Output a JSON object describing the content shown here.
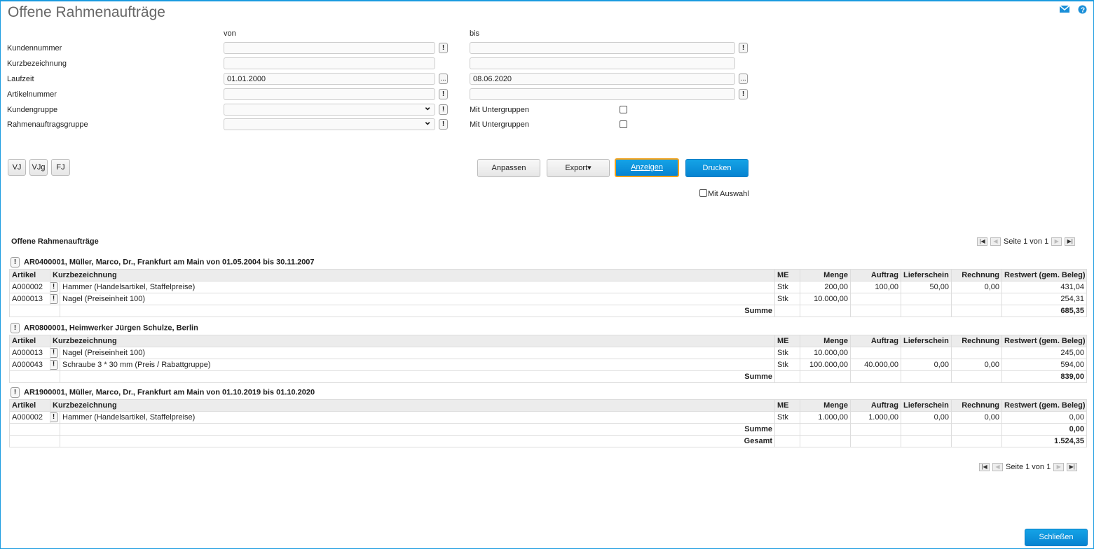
{
  "title": "Offene Rahmenaufträge",
  "icons": {
    "mail": "mail-icon",
    "help": "help-icon"
  },
  "filter": {
    "von": "von",
    "bis": "bis",
    "rows": [
      {
        "label": "Kundennummer",
        "von": "",
        "bis": ""
      },
      {
        "label": "Kurzbezeichnung",
        "von": "",
        "bis": ""
      },
      {
        "label": "Laufzeit",
        "von": "01.01.2000",
        "bis": "08.06.2020"
      },
      {
        "label": "Artikelnummer",
        "von": "",
        "bis": ""
      },
      {
        "label": "Kundengruppe",
        "von": "",
        "bis": "Mit Untergruppen"
      },
      {
        "label": "Rahmenauftragsgruppe",
        "von": "",
        "bis": "Mit Untergruppen"
      }
    ],
    "ellipsis": "...",
    "excl": "!"
  },
  "quick": [
    "VJ",
    "VJg",
    "FJ"
  ],
  "buttons": {
    "anpassen": "Anpassen",
    "export": "Export▾",
    "anzeigen": "Anzeigen",
    "drucken": "Drucken",
    "mit_auswahl": "Mit Auswahl",
    "schliessen": "Schließen"
  },
  "report": {
    "title": "Offene Rahmenaufträge",
    "pager": "Seite 1 von 1",
    "columns": [
      "Artikel",
      "Kurzbezeichnung",
      "ME",
      "Menge",
      "Auftrag",
      "Lieferschein",
      "Rechnung",
      "Restwert (gem. Beleg)"
    ],
    "groups": [
      {
        "title": "AR0400001, Müller, Marco, Dr., Frankfurt am Main von 01.05.2004 bis 30.11.2007",
        "rows": [
          [
            "A000002",
            "Hammer (Handelsartikel, Staffelpreise)",
            "Stk",
            "200,00",
            "100,00",
            "50,00",
            "0,00",
            "431,04"
          ],
          [
            "A000013",
            "Nagel (Preiseinheit 100)",
            "Stk",
            "10.000,00",
            "",
            "",
            "",
            "254,31"
          ]
        ],
        "summe_label": "Summe",
        "summe": "685,35"
      },
      {
        "title": "AR0800001, Heimwerker Jürgen Schulze, Berlin",
        "rows": [
          [
            "A000013",
            "Nagel (Preiseinheit 100)",
            "Stk",
            "10.000,00",
            "",
            "",
            "",
            "245,00"
          ],
          [
            "A000043",
            "Schraube 3 * 30 mm (Preis / Rabattgruppe)",
            "Stk",
            "100.000,00",
            "40.000,00",
            "0,00",
            "0,00",
            "594,00"
          ]
        ],
        "summe_label": "Summe",
        "summe": "839,00"
      },
      {
        "title": "AR1900001, Müller, Marco, Dr., Frankfurt am Main von 01.10.2019 bis 01.10.2020",
        "rows": [
          [
            "A000002",
            "Hammer (Handelsartikel, Staffelpreise)",
            "Stk",
            "1.000,00",
            "1.000,00",
            "0,00",
            "0,00",
            "0,00"
          ]
        ],
        "summe_label": "Summe",
        "summe": "0,00",
        "gesamt_label": "Gesamt",
        "gesamt": "1.524,35"
      }
    ]
  }
}
